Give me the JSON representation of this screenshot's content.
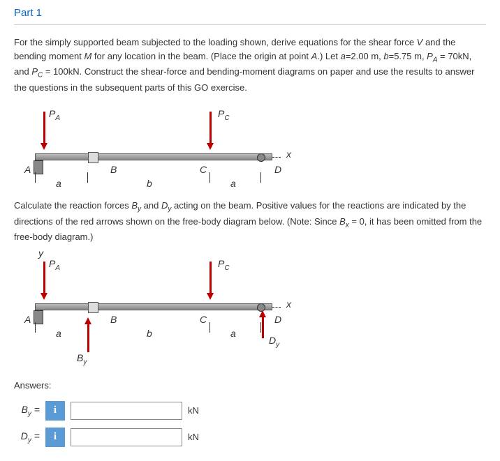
{
  "part_title": "Part 1",
  "problem_text": "For the simply supported beam subjected to the loading shown, derive equations for the shear force V and the bending moment M for any location in the beam. (Place the origin at point A.) Let a=2.00 m, b=5.75 m, P_A = 70kN, and P_C = 100kN. Construct the shear-force and bending-moment diagrams on paper and use the results to answer the questions in the subsequent parts of this GO exercise.",
  "labels": {
    "PA": "P_A",
    "PC": "P_C",
    "A": "A",
    "B": "B",
    "C": "C",
    "D": "D",
    "a": "a",
    "b": "b",
    "x": "x",
    "y": "y",
    "By": "B_y",
    "Dy": "D_y"
  },
  "calc_text": "Calculate the reaction forces B_y and D_y acting on the beam. Positive values for the reactions are indicated by the directions of the red arrows shown on the free-body diagram below. (Note: Since B_x = 0, it has been omitted from the free-body diagram.)",
  "answers_label": "Answers:",
  "rows": [
    {
      "label": "B_y =",
      "unit": "kN"
    },
    {
      "label": "D_y =",
      "unit": "kN"
    }
  ],
  "info_icon": "i"
}
